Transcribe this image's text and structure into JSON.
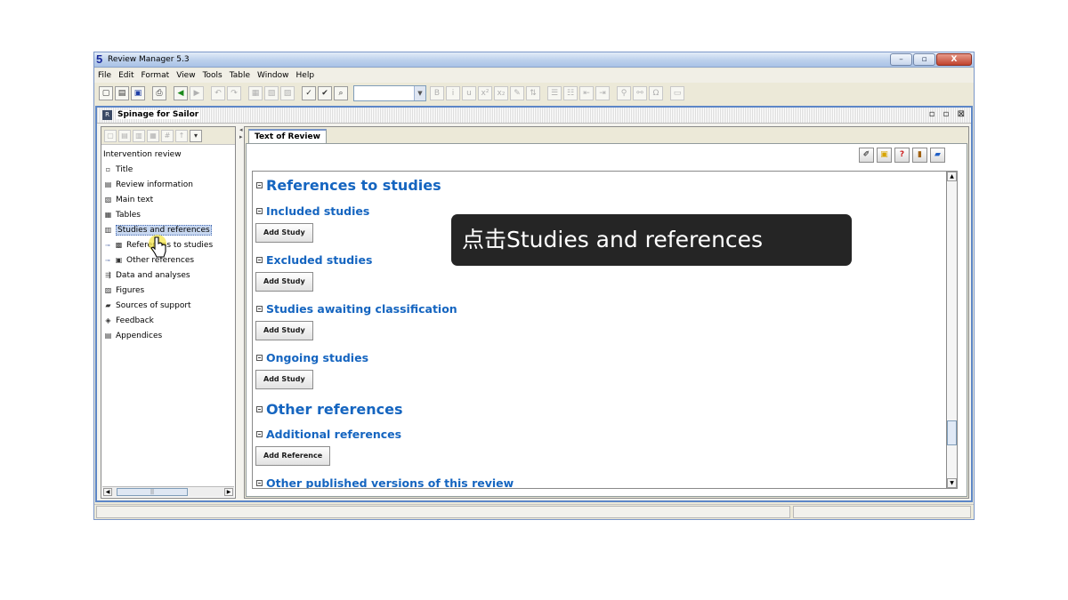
{
  "window": {
    "title": "Review Manager 5.3",
    "logo": "5",
    "controls": {
      "minimize": "–",
      "maximize": "▫",
      "close": "X"
    }
  },
  "menu": [
    "File",
    "Edit",
    "Format",
    "View",
    "Tools",
    "Table",
    "Window",
    "Help"
  ],
  "toolbar": {
    "buttons": [
      "new-icon",
      "open-icon",
      "save-icon",
      "print-icon",
      "back-arrow-icon",
      "forward-arrow-icon",
      "undo-icon",
      "redo-icon",
      "copy-icon",
      "paste-icon",
      "delete-icon",
      "spellcheck-icon",
      "spellcheck-all-icon",
      "find-icon"
    ],
    "style_value": "",
    "format_buttons": {
      "bold": "B",
      "italic": "i",
      "underline": "u",
      "superscript": "x²",
      "subscript": "x₂",
      "omega": "Ω"
    }
  },
  "document": {
    "name": "Spinage for Sailor",
    "controls": "▫ ▫ ⊠"
  },
  "tree": {
    "root": "Intervention review",
    "items": [
      {
        "label": "Title",
        "icon": "document-icon"
      },
      {
        "label": "Review information",
        "icon": "info-icon"
      },
      {
        "label": "Main text",
        "icon": "text-icon"
      },
      {
        "label": "Tables",
        "icon": "table-icon"
      },
      {
        "label": "Studies and references",
        "icon": "books-icon",
        "selected": true
      },
      {
        "label": "References to studies",
        "icon": "references-icon",
        "child": true
      },
      {
        "label": "Other references",
        "icon": "book-icon",
        "child": true
      },
      {
        "label": "Data and analyses",
        "icon": "data-icon"
      },
      {
        "label": "Figures",
        "icon": "figure-icon"
      },
      {
        "label": "Sources of support",
        "icon": "support-icon"
      },
      {
        "label": "Feedback",
        "icon": "feedback-icon"
      },
      {
        "label": "Appendices",
        "icon": "appendix-icon"
      }
    ]
  },
  "tab": {
    "label": "Text of Review"
  },
  "content": {
    "references_to_studies": "References to studies",
    "included": "Included studies",
    "excluded": "Excluded studies",
    "awaiting": "Studies awaiting classification",
    "ongoing": "Ongoing studies",
    "other_references": "Other references",
    "additional": "Additional references",
    "other_published": "Other published versions of this review",
    "add_study": "Add Study",
    "add_reference": "Add Reference"
  },
  "tooltip": "点击Studies and references",
  "colors": {
    "heading": "#1565c0",
    "title_bar": "#bcd0ec",
    "frame_border": "#5c86c7"
  }
}
